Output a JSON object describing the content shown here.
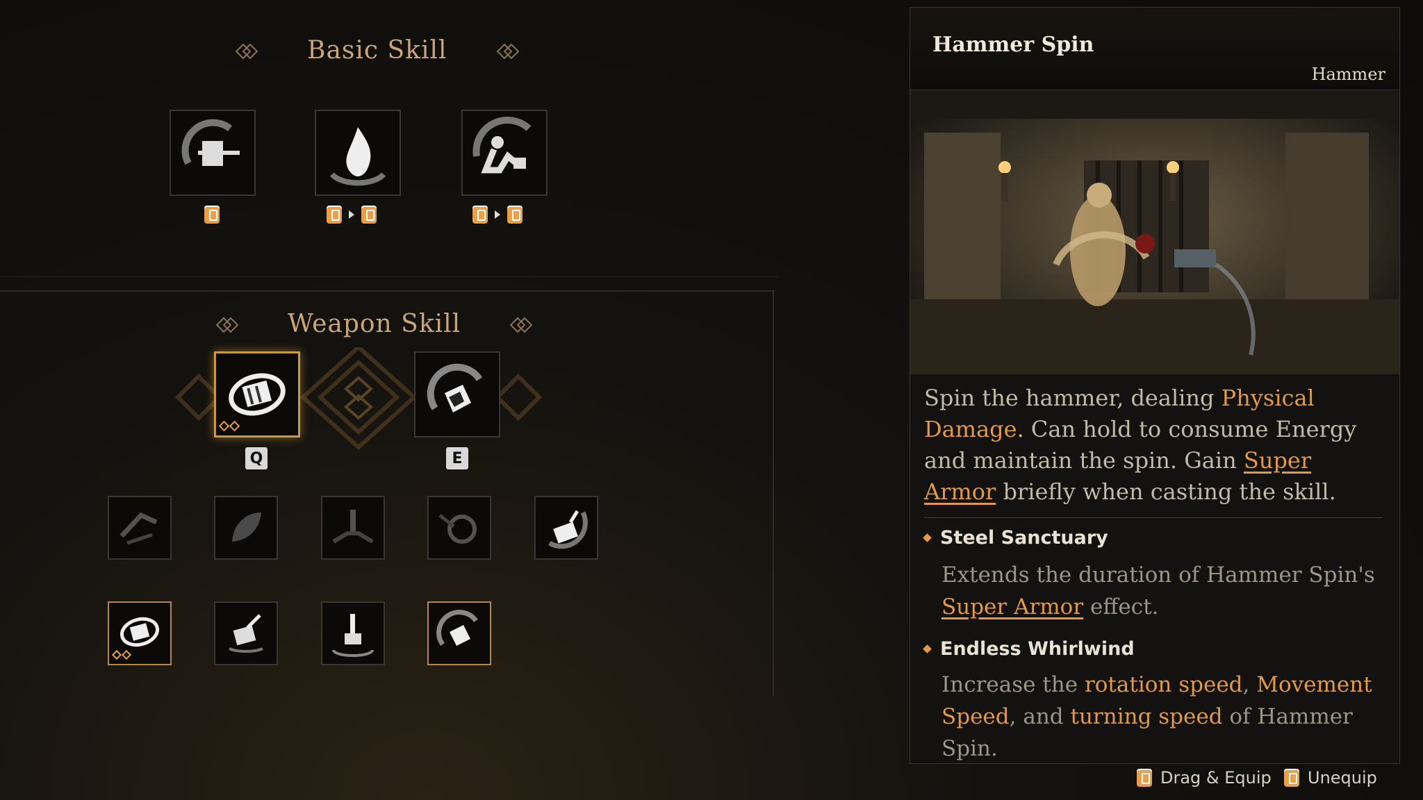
{
  "basic": {
    "title": "Basic Skill",
    "skills": [
      {
        "icon": "hammer-swing-skill-icon",
        "inputs": [
          "mouse-left"
        ]
      },
      {
        "icon": "flame-skill-icon",
        "inputs": [
          "mouse-left",
          "mouse-left"
        ]
      },
      {
        "icon": "crouch-strike-skill-icon",
        "inputs": [
          "mouse-left",
          "mouse-left"
        ]
      }
    ]
  },
  "weapon": {
    "title": "Weapon Skill",
    "equipped": [
      {
        "icon": "hammer-spin-skill-icon",
        "key": "Q",
        "selected": true
      },
      {
        "icon": "hammer-smash-skill-icon",
        "key": "E",
        "selected": false
      }
    ],
    "row1": [
      "dash-strike-icon",
      "leaf-slash-icon",
      "ground-impact-icon",
      "shield-burst-icon",
      "hammer-throw-icon"
    ],
    "row2": [
      "hammer-spin-icon",
      "hammer-upgrade-icon",
      "ground-slam-icon",
      "hammer-smash-icon"
    ]
  },
  "detail": {
    "title": "Hammer Spin",
    "category": "Hammer",
    "desc": {
      "p1": "Spin the hammer, dealing ",
      "h1": "Physical Damage",
      "p2": ". Can hold to consume Energy and maintain the spin. Gain ",
      "u1": "Super Armor",
      "p3": " briefly when casting the skill."
    },
    "traits": [
      {
        "name": "Steel Sanctuary",
        "p1": "Extends the duration of Hammer Spin's ",
        "u1": "Super Armor",
        "p2": " effect."
      },
      {
        "name": "Endless Whirlwind",
        "p1": "Increase the ",
        "h1": "rotation speed",
        "p2": ", ",
        "h2": "Movement Speed",
        "p3": ", and ",
        "h3": "turning speed",
        "p4": " of Hammer Spin."
      }
    ]
  },
  "footer": {
    "drag": "Drag & Equip",
    "unequip": "Unequip"
  },
  "colors": {
    "accent": "#e39a48",
    "gold": "#c9a67a",
    "selected_border": "#c99a45"
  }
}
